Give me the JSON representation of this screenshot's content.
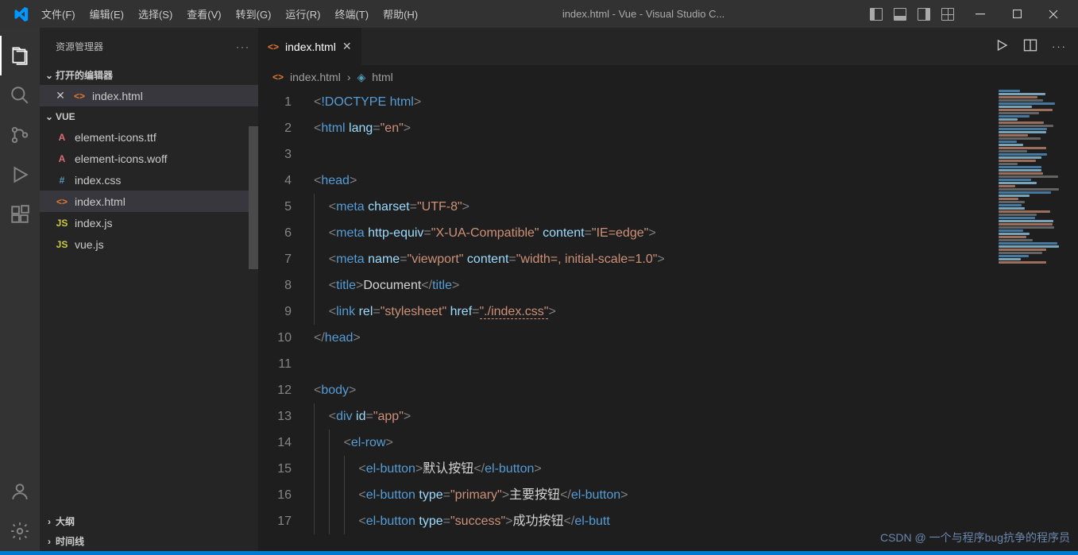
{
  "titlebar": {
    "menus": [
      "文件(F)",
      "编辑(E)",
      "选择(S)",
      "查看(V)",
      "转到(G)",
      "运行(R)",
      "终端(T)",
      "帮助(H)"
    ],
    "title": "index.html - Vue - Visual Studio C..."
  },
  "sidebar": {
    "title": "资源管理器",
    "open_editors_label": "打开的编辑器",
    "open_editors": [
      {
        "name": "index.html",
        "icon": "<>",
        "iconClass": "icon-html",
        "active": true,
        "closeable": true
      }
    ],
    "folder_label": "VUE",
    "files": [
      {
        "name": "element-icons.ttf",
        "icon": "A",
        "iconClass": "icon-font"
      },
      {
        "name": "element-icons.woff",
        "icon": "A",
        "iconClass": "icon-font"
      },
      {
        "name": "index.css",
        "icon": "#",
        "iconClass": "icon-css"
      },
      {
        "name": "index.html",
        "icon": "<>",
        "iconClass": "icon-html",
        "active": true
      },
      {
        "name": "index.js",
        "icon": "JS",
        "iconClass": "icon-js"
      },
      {
        "name": "vue.js",
        "icon": "JS",
        "iconClass": "icon-js"
      }
    ],
    "outline_label": "大纲",
    "timeline_label": "时间线"
  },
  "editor": {
    "tab": {
      "name": "index.html",
      "icon": "<>"
    },
    "breadcrumb": {
      "file": "index.html",
      "symbol": "html"
    },
    "lines": [
      {
        "n": 1,
        "tokens": [
          [
            "punc",
            "<"
          ],
          [
            "doctype",
            "!DOCTYPE"
          ],
          [
            "text",
            " "
          ],
          [
            "tag",
            "html"
          ],
          [
            "punc",
            ">"
          ]
        ]
      },
      {
        "n": 2,
        "tokens": [
          [
            "punc",
            "<"
          ],
          [
            "tag",
            "html"
          ],
          [
            "text",
            " "
          ],
          [
            "attr",
            "lang"
          ],
          [
            "punc",
            "="
          ],
          [
            "str",
            "\"en\""
          ],
          [
            "punc",
            ">"
          ]
        ]
      },
      {
        "n": 3,
        "tokens": []
      },
      {
        "n": 4,
        "tokens": [
          [
            "punc",
            "<"
          ],
          [
            "tag",
            "head"
          ],
          [
            "punc",
            ">"
          ]
        ]
      },
      {
        "n": 5,
        "indent": 1,
        "tokens": [
          [
            "punc",
            "<"
          ],
          [
            "tag",
            "meta"
          ],
          [
            "text",
            " "
          ],
          [
            "attr",
            "charset"
          ],
          [
            "punc",
            "="
          ],
          [
            "str",
            "\"UTF-8\""
          ],
          [
            "punc",
            ">"
          ]
        ]
      },
      {
        "n": 6,
        "indent": 1,
        "tokens": [
          [
            "punc",
            "<"
          ],
          [
            "tag",
            "meta"
          ],
          [
            "text",
            " "
          ],
          [
            "attr",
            "http-equiv"
          ],
          [
            "punc",
            "="
          ],
          [
            "str",
            "\"X-UA-Compatible\""
          ],
          [
            "text",
            " "
          ],
          [
            "attr",
            "content"
          ],
          [
            "punc",
            "="
          ],
          [
            "str",
            "\"IE=edge\""
          ],
          [
            "punc",
            ">"
          ]
        ]
      },
      {
        "n": 7,
        "indent": 1,
        "tokens": [
          [
            "punc",
            "<"
          ],
          [
            "tag",
            "meta"
          ],
          [
            "text",
            " "
          ],
          [
            "attr",
            "name"
          ],
          [
            "punc",
            "="
          ],
          [
            "str",
            "\"viewport\""
          ],
          [
            "text",
            " "
          ],
          [
            "attr",
            "content"
          ],
          [
            "punc",
            "="
          ],
          [
            "str",
            "\"width=, initial-scale=1.0\""
          ],
          [
            "punc",
            ">"
          ]
        ]
      },
      {
        "n": 8,
        "indent": 1,
        "tokens": [
          [
            "punc",
            "<"
          ],
          [
            "tag",
            "title"
          ],
          [
            "punc",
            ">"
          ],
          [
            "text",
            "Document"
          ],
          [
            "punc",
            "</"
          ],
          [
            "tag",
            "title"
          ],
          [
            "punc",
            ">"
          ]
        ]
      },
      {
        "n": 9,
        "indent": 1,
        "tokens": [
          [
            "punc",
            "<"
          ],
          [
            "tag",
            "link"
          ],
          [
            "text",
            " "
          ],
          [
            "attr",
            "rel"
          ],
          [
            "punc",
            "="
          ],
          [
            "str",
            "\"stylesheet\""
          ],
          [
            "text",
            " "
          ],
          [
            "attr",
            "href"
          ],
          [
            "punc",
            "="
          ],
          [
            "str-underline",
            "\"./index.css\""
          ],
          [
            "punc",
            ">"
          ]
        ]
      },
      {
        "n": 10,
        "tokens": [
          [
            "punc",
            "</"
          ],
          [
            "tag",
            "head"
          ],
          [
            "punc",
            ">"
          ]
        ]
      },
      {
        "n": 11,
        "tokens": []
      },
      {
        "n": 12,
        "tokens": [
          [
            "punc",
            "<"
          ],
          [
            "tag",
            "body"
          ],
          [
            "punc",
            ">"
          ]
        ]
      },
      {
        "n": 13,
        "indent": 1,
        "tokens": [
          [
            "punc",
            "<"
          ],
          [
            "tag",
            "div"
          ],
          [
            "text",
            " "
          ],
          [
            "attr",
            "id"
          ],
          [
            "punc",
            "="
          ],
          [
            "str",
            "\"app\""
          ],
          [
            "punc",
            ">"
          ]
        ]
      },
      {
        "n": 14,
        "indent": 2,
        "tokens": [
          [
            "punc",
            "<"
          ],
          [
            "tag",
            "el-row"
          ],
          [
            "punc",
            ">"
          ]
        ]
      },
      {
        "n": 15,
        "indent": 3,
        "tokens": [
          [
            "punc",
            "<"
          ],
          [
            "tag",
            "el-button"
          ],
          [
            "punc",
            ">"
          ],
          [
            "text",
            "默认按钮"
          ],
          [
            "punc",
            "</"
          ],
          [
            "tag",
            "el-button"
          ],
          [
            "punc",
            ">"
          ]
        ]
      },
      {
        "n": 16,
        "indent": 3,
        "tokens": [
          [
            "punc",
            "<"
          ],
          [
            "tag",
            "el-button"
          ],
          [
            "text",
            " "
          ],
          [
            "attr",
            "type"
          ],
          [
            "punc",
            "="
          ],
          [
            "str",
            "\"primary\""
          ],
          [
            "punc",
            ">"
          ],
          [
            "text",
            "主要按钮"
          ],
          [
            "punc",
            "</"
          ],
          [
            "tag",
            "el-button"
          ],
          [
            "punc",
            ">"
          ]
        ]
      },
      {
        "n": 17,
        "indent": 3,
        "tokens": [
          [
            "punc",
            "<"
          ],
          [
            "tag",
            "el-button"
          ],
          [
            "text",
            " "
          ],
          [
            "attr",
            "type"
          ],
          [
            "punc",
            "="
          ],
          [
            "str",
            "\"success\""
          ],
          [
            "punc",
            ">"
          ],
          [
            "text",
            "成功按钮"
          ],
          [
            "punc",
            "</"
          ],
          [
            "tag",
            "el-butt"
          ]
        ]
      }
    ]
  },
  "watermark": "CSDN @ 一个与程序bug抗争的程序员"
}
